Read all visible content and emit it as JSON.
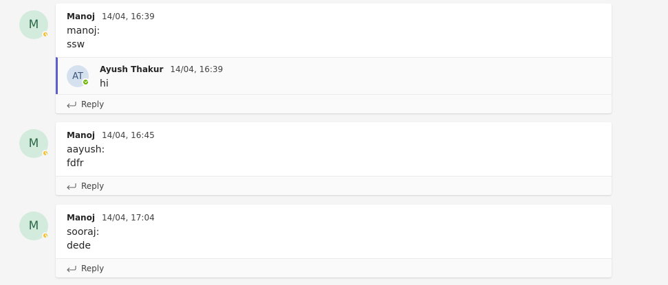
{
  "posts": [
    {
      "avatar": "M",
      "author": "Manoj",
      "time": "14/04, 16:39",
      "lines": [
        "manoj:",
        "ssw"
      ],
      "reply": {
        "avatar": "AT",
        "author": "Ayush Thakur",
        "time": "14/04, 16:39",
        "text": "hi"
      },
      "reply_label": "Reply"
    },
    {
      "avatar": "M",
      "author": "Manoj",
      "time": "14/04, 16:45",
      "lines": [
        "aayush:",
        "fdfr"
      ],
      "reply_label": "Reply"
    },
    {
      "avatar": "M",
      "author": "Manoj",
      "time": "14/04, 17:04",
      "lines": [
        "sooraj:",
        "dede"
      ],
      "reply_label": "Reply"
    }
  ],
  "colors": {
    "accent": "#5b5fc7",
    "away": "#f8c12d",
    "available": "#6bb700"
  },
  "icons": {
    "presence_away": "clock-icon",
    "presence_available": "check-icon",
    "reply": "reply-arrow-icon"
  }
}
